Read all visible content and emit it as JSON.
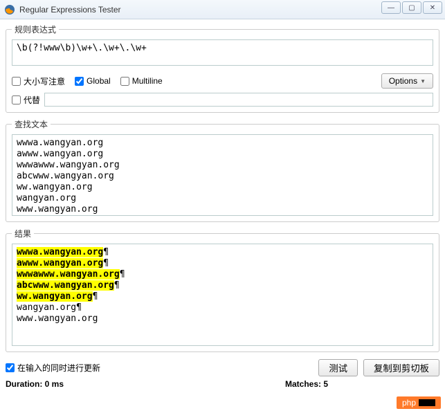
{
  "window": {
    "title": "Regular Expressions Tester"
  },
  "regex": {
    "legend": "规则表达式",
    "pattern": "\\b(?!www\\b)\\w+\\.\\w+\\.\\w+",
    "case_label": "大小写注意",
    "global_label": "Global",
    "multiline_label": "Multiline",
    "options_label": "Options",
    "replace_label": "代替",
    "replace_value": ""
  },
  "search": {
    "legend": "查找文本",
    "text": "wwwa.wangyan.org\nawww.wangyan.org\nwwwawww.wangyan.org\nabcwww.wangyan.org\nww.wangyan.org\nwangyan.org\nwww.wangyan.org"
  },
  "results": {
    "legend": "结果",
    "lines": [
      {
        "match": "wwwa.wangyan.org",
        "rest": "¶"
      },
      {
        "match": "awww.wangyan.org",
        "rest": "¶"
      },
      {
        "match": "wwwawww.wangyan.org",
        "rest": "¶"
      },
      {
        "match": "abcwww.wangyan.org",
        "rest": "¶"
      },
      {
        "match": "ww.wangyan.org",
        "rest": "¶"
      },
      {
        "match": "",
        "rest": "wangyan.org¶"
      },
      {
        "match": "",
        "rest": "www.wangyan.org"
      }
    ]
  },
  "footer": {
    "auto_update_label": "在输入的同时进行更新",
    "test_label": "测试",
    "copy_label": "复制到剪切板",
    "duration_label": "Duration: 0 ms",
    "matches_label": "Matches: 5"
  },
  "watermark": "php"
}
